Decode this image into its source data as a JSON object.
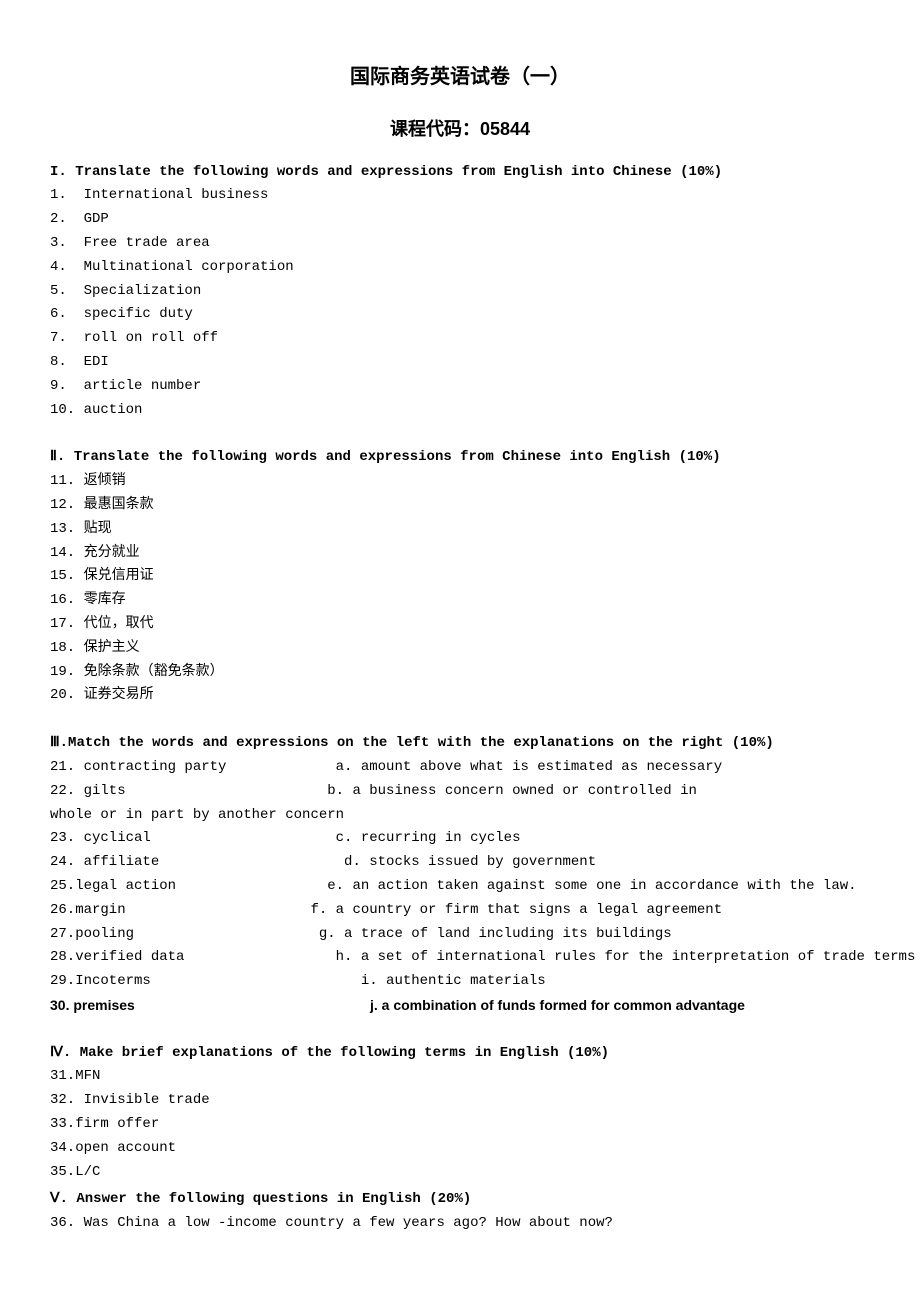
{
  "title": "国际商务英语试卷（一）",
  "subtitle": "课程代码：05844",
  "s1": {
    "head": "I. Translate the following words and expressions from English into Chinese (10%)",
    "i1": "1.  International business",
    "i2": "2.  GDP",
    "i3": "3.  Free trade area",
    "i4": "4.  Multinational corporation",
    "i5": "5.  Specialization",
    "i6": "6.  specific duty",
    "i7": "7.  roll on roll off",
    "i8": "8.  EDI",
    "i9": "9.  article number",
    "i10": "10. auction"
  },
  "s2": {
    "head": "Ⅱ. Translate the following words and expressions from Chinese into English (10%)",
    "i11": "11. 返倾销",
    "i12": "12. 最惠国条款",
    "i13": "13. 贴现",
    "i14": "14. 充分就业",
    "i15": "15. 保兑信用证",
    "i16": "16. 零库存",
    "i17": "17. 代位，取代",
    "i18": "18. 保护主义",
    "i19": "19. 免除条款（豁免条款）",
    "i20": "20. 证券交易所"
  },
  "s3": {
    "head": "Ⅲ.Match the words and expressions on the left with the explanations on the right  (10%)",
    "r21": "21. contracting party             a. amount above what is estimated as necessary",
    "r22": "22. gilts                        b. a business concern owned or controlled in",
    "r22b": "whole or in part by another concern",
    "r23": "23. cyclical                      c. recurring in cycles",
    "r24": "24. affiliate                      d. stocks issued by government",
    "r25": "25.legal action                  e. an action taken against some one in accordance with the law.",
    "r26": "26.margin                      f. a country or firm that signs a legal agreement",
    "r27": "27.pooling                      g. a trace of land including its buildings",
    "r28": "28.verified data                  h. a set of international rules for the interpretation of trade terms",
    "r29": "29.Incoterms                         i. authentic materials",
    "r30a": "30. premises",
    "r30b": "j. a combination of funds formed for common advantage"
  },
  "s4": {
    "head": "Ⅳ. Make brief explanations of the following terms in English (10%)",
    "i31": "31.MFN",
    "i32": "32. Invisible trade",
    "i33": "33.firm offer",
    "i34": "34.open account",
    "i35": "35.L/C"
  },
  "s5": {
    "head": "Ⅴ. Answer the following questions in English (20%)",
    "i36": "36. Was China a low -income country a few years ago? How about now?"
  }
}
